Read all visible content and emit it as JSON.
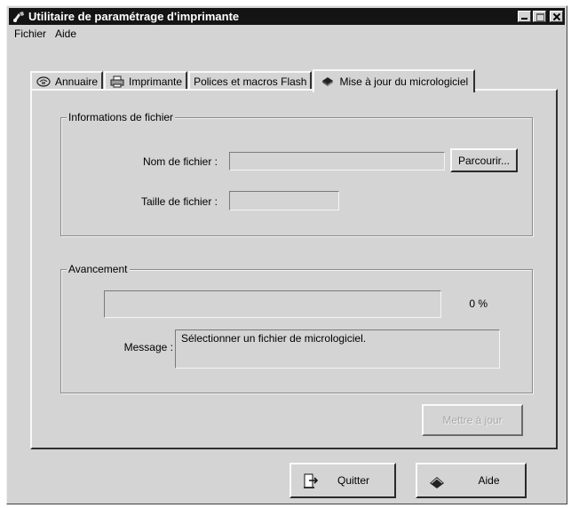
{
  "window": {
    "title": "Utilitaire de paramétrage d'imprimante",
    "icon": "printer-setup-icon"
  },
  "menu": [
    "Fichier",
    "Aide"
  ],
  "tabs": [
    {
      "label": "Annuaire",
      "icon": "address-book-icon",
      "active": false
    },
    {
      "label": "Imprimante",
      "icon": "printer-icon",
      "active": false
    },
    {
      "label": "Polices et macros Flash",
      "icon": "",
      "active": false
    },
    {
      "label": "Mise à jour du micrologiciel",
      "icon": "chip-icon",
      "active": true
    }
  ],
  "file_info": {
    "group_label": "Informations de fichier",
    "filename_label": "Nom de fichier :",
    "filename_value": "",
    "browse_label": "Parcourir...",
    "filesize_label": "Taille de fichier :",
    "filesize_value": ""
  },
  "progress": {
    "group_label": "Avancement",
    "percent": 0,
    "percent_text": "0 %",
    "message_label": "Message :",
    "message_value": "Sélectionner un fichier de micrologiciel."
  },
  "update_button": {
    "label": "Mettre à jour",
    "enabled": false
  },
  "footer": {
    "quit_label": "Quitter",
    "quit_icon": "exit-icon",
    "help_label": "Aide",
    "help_icon": "book-icon"
  }
}
